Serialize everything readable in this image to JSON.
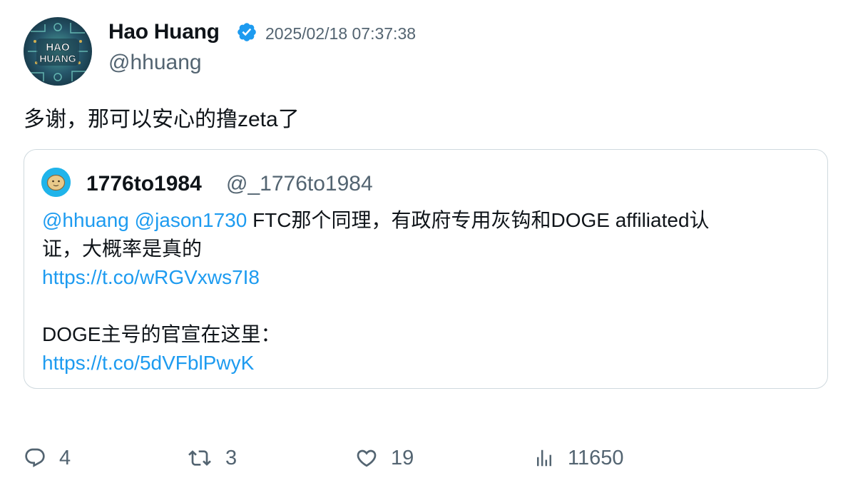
{
  "tweet": {
    "author": {
      "display_name": "Hao Huang",
      "handle": "@hhuang",
      "verified": true,
      "avatar_text_line1": "HAO",
      "avatar_text_line2": "HUANG"
    },
    "timestamp": "2025/02/18 07:37:38",
    "text": "多谢，那可以安心的撸zeta了"
  },
  "quoted_tweet": {
    "author": {
      "display_name": "1776to1984",
      "handle": "@_1776to1984"
    },
    "mention_1": "@hhuang",
    "mention_2": "@jason1730",
    "text_line1": " FTC那个同理，有政府专用灰钩和DOGE affiliated认",
    "text_line2": "证，大概率是真的",
    "link_1": "https://t.co/wRGVxws7I8",
    "text_line3": "DOGE主号的官宣在这里：",
    "link_2": "https://t.co/5dVFblPwyK"
  },
  "actions": {
    "replies": "4",
    "retweets": "3",
    "likes": "19",
    "views": "11650"
  },
  "colors": {
    "link": "#1d9bf0",
    "muted": "#536471",
    "border": "#cfd9de",
    "verified_badge": "#1d9bf0"
  },
  "icons": {
    "verified": "verified-badge-icon",
    "reply": "reply-bubble-icon",
    "retweet": "retweet-icon",
    "like": "heart-icon",
    "views": "bar-chart-icon"
  }
}
